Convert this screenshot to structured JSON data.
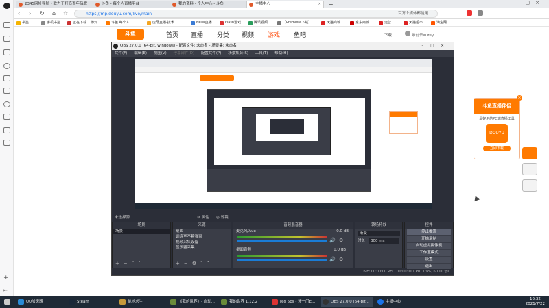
{
  "browser": {
    "tabs": [
      {
        "label": "2345网址导航 - 致力于打造百年品牌"
      },
      {
        "label": "斗鱼 - 每个人直播平台"
      },
      {
        "label": "我的资料 - 个人中心 - 斗鱼"
      },
      {
        "label": "主播中心",
        "active": true
      }
    ],
    "new_tab": "+",
    "url": "https://mp.douyu.com/live/main",
    "search_hint": "百万个媒体都能用"
  },
  "bookmarks": [
    {
      "label": "书签"
    },
    {
      "label": "手机书签"
    },
    {
      "label": "正在下载... 谁知"
    },
    {
      "label": "斗鱼 每个人..."
    },
    {
      "label": "虎牙直播-技术..."
    },
    {
      "label": "NOW直播"
    },
    {
      "label": "Flash游戏"
    },
    {
      "label": "腾讯视频"
    },
    {
      "label": "【Premiere下载】"
    },
    {
      "label": "天猫商城"
    },
    {
      "label": "京东商城"
    },
    {
      "label": "运营..."
    },
    {
      "label": "天猫超市"
    },
    {
      "label": "淘宝网"
    }
  ],
  "site": {
    "logo": "斗鱼",
    "nav": [
      "首页",
      "直播",
      "分类",
      "视频",
      "游戏",
      "鱼吧"
    ],
    "download": "下载",
    "user": "唯创乐aurey"
  },
  "obs": {
    "title": "OBS 27.0.0 (64-bit, windows) - 配置文件: 未命名 - 场景集: 未命名",
    "menu": [
      "文件(F)",
      "编辑(E)",
      "视图(V)",
      "停靠部件(D)",
      "配置文件(P)",
      "场景集合(S)",
      "工具(T)",
      "帮助(H)"
    ],
    "no_source": "未选择源",
    "properties": "属性",
    "filters": "滤镜",
    "docks": {
      "scenes": {
        "title": "场景",
        "items": [
          "场景"
        ]
      },
      "sources": {
        "title": "来源",
        "items": [
          "桌面",
          "训练室不着弹窗",
          "视频采集设备",
          "显示器采集"
        ]
      },
      "mixer": {
        "title": "音频混音器",
        "channels": [
          {
            "name": "麦克风/Aux",
            "db": "0.0 dB"
          },
          {
            "name": "桌面音频",
            "db": "0.0 dB"
          }
        ]
      },
      "transitions": {
        "title": "转场特效",
        "type": "渐变",
        "duration_label": "时长",
        "duration": "300 ms"
      },
      "controls": {
        "title": "控件",
        "buttons": [
          "停止推流",
          "开始录制",
          "启动虚拟摄像机",
          "工作室模式",
          "设置",
          "退出"
        ]
      }
    },
    "status": "LIVE: 00:00:00   REC: 00:00:00   CPU: 1.9%, 60.00 fps"
  },
  "ad": {
    "title": "斗鱼直播伴侣",
    "text": "最好用的PC端直播工具",
    "logo": "DOUYU",
    "button": "立即下载"
  },
  "taskbar": {
    "items": [
      {
        "label": "UU加速器"
      },
      {
        "label": "Steam"
      },
      {
        "label": "绝地求生"
      },
      {
        "label": "《我的世界》- 启动..."
      },
      {
        "label": "我的世界 1.12.2"
      },
      {
        "label": "red 5ps - 涉一门E..."
      },
      {
        "label": "OBS 27.0.0 (64-bit..."
      },
      {
        "label": "主播中心"
      }
    ],
    "time": "16:32",
    "date": "2021/7/22"
  }
}
